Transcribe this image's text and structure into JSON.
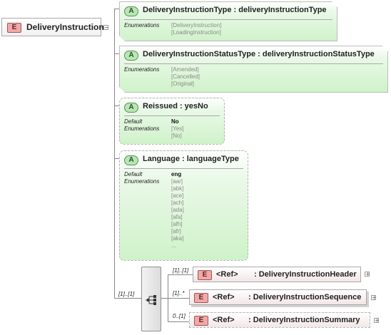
{
  "root": {
    "badge": "E",
    "label": "DeliveryInstruction",
    "expander": "−"
  },
  "attributes": [
    {
      "badge": "A",
      "title": "DeliveryInstructionType : deliveryInstructionType",
      "enumerations_label": "Enumerations",
      "enumerations": [
        "[DeliveryInstruction]",
        "[LoadingInstruction]"
      ]
    },
    {
      "badge": "A",
      "title": "DeliveryInstructionStatusType : deliveryInstructionStatusType",
      "enumerations_label": "Enumerations",
      "enumerations": [
        "[Amended]",
        "[Cancelled]",
        "[Original]"
      ]
    },
    {
      "badge": "A",
      "title": "Reissued : yesNo",
      "default_label": "Default",
      "default_value": "No",
      "enumerations_label": "Enumerations",
      "enumerations": [
        "[Yes]",
        "[No]"
      ]
    },
    {
      "badge": "A",
      "title": "Language : languageType",
      "default_label": "Default",
      "default_value": "eng",
      "enumerations_label": "Enumerations",
      "enumerations": [
        "[aar]",
        "[abk]",
        "[ace]",
        "[ach]",
        "[ada]",
        "[afa]",
        "[afh]",
        "[afr]",
        "[aka]",
        "..."
      ]
    }
  ],
  "sequence": {
    "occurrence": "[1]..[1]",
    "children": [
      {
        "occurrence": "[1]..[1]",
        "badge": "E",
        "ref_tag": "<Ref>",
        "name": ": DeliveryInstructionHeader",
        "expander": "+"
      },
      {
        "occurrence": "[1]..*",
        "badge": "E",
        "ref_tag": "<Ref>",
        "name": ": DeliveryInstructionSequence",
        "expander": "+"
      },
      {
        "occurrence": "0..[1]",
        "badge": "E",
        "ref_tag": "<Ref>",
        "name": ": DeliveryInstructionSummary",
        "expander": "+"
      }
    ]
  },
  "colors": {
    "element_badge": "#f3a8a8",
    "attribute_badge": "#b7e8b3",
    "attribute_fill": "#cff2c9",
    "connector": "#888888"
  }
}
